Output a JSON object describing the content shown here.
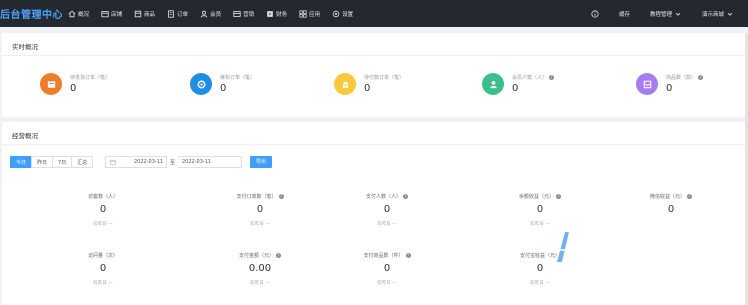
{
  "header": {
    "brand": "后台管理中心",
    "nav": [
      {
        "label": "概况",
        "icon": "home-icon"
      },
      {
        "label": "店铺",
        "icon": "store-icon"
      },
      {
        "label": "商品",
        "icon": "goods-icon"
      },
      {
        "label": "订单",
        "icon": "order-icon"
      },
      {
        "label": "会员",
        "icon": "member-icon"
      },
      {
        "label": "营销",
        "icon": "marketing-icon"
      },
      {
        "label": "财务",
        "icon": "finance-icon"
      },
      {
        "label": "应用",
        "icon": "apps-icon"
      },
      {
        "label": "设置",
        "icon": "gear-icon"
      }
    ],
    "cache_label": "缓存",
    "tutorial_label": "教程管理",
    "demo_label": "演示商城"
  },
  "realtime": {
    "title": "实时概况",
    "stats": [
      {
        "label": "待发货订单（笔）",
        "value": "0",
        "color": "#ee7d2c",
        "icon": "order-box-icon",
        "help": false
      },
      {
        "label": "维权订单（笔）",
        "value": "0",
        "color": "#1e8ee4",
        "icon": "refresh-icon",
        "help": false
      },
      {
        "label": "待付款订单（笔）",
        "value": "0",
        "color": "#f8c83d",
        "icon": "money-bag-icon",
        "help": false
      },
      {
        "label": "会员户数（人）",
        "value": "0",
        "color": "#3cbf8b",
        "icon": "user-icon",
        "help": true
      },
      {
        "label": "商品数（款）",
        "value": "0",
        "color": "#a67cf0",
        "icon": "product-icon",
        "help": true
      }
    ]
  },
  "business": {
    "title": "经营概况",
    "range_tabs": [
      "今日",
      "昨日",
      "7日",
      "汇总"
    ],
    "active_tab": "今日",
    "start_date": "2022-03-11",
    "to_label": "至",
    "end_date": "2022-03-11",
    "export_label": "导出",
    "metrics_row1": [
      {
        "label": "访客数（人）",
        "value": "0",
        "sub": "较昨日 —",
        "help": false
      },
      {
        "label": "支付订单数（笔）",
        "value": "0",
        "sub": "较昨日 —",
        "help": true
      },
      {
        "label": "支付人数（人）",
        "value": "0",
        "sub": "较昨日 —",
        "help": true
      },
      {
        "label": "余额收益（元）",
        "value": "0",
        "sub": "较昨日 —",
        "help": true
      },
      {
        "label": "微信收益（元）",
        "value": "0",
        "sub": "",
        "help": true
      }
    ],
    "metrics_row2": [
      {
        "label": "访问量（次）",
        "value": "0",
        "sub": "较昨日 —",
        "help": false
      },
      {
        "label": "支付金额（元）",
        "value": "0.00",
        "sub": "较昨日 —",
        "help": true
      },
      {
        "label": "支付商品数（件）",
        "value": "0",
        "sub": "较昨日 —",
        "help": true
      },
      {
        "label": "支付宝收益（元）",
        "value": "0",
        "sub": "较昨日 —",
        "help": false
      }
    ]
  }
}
